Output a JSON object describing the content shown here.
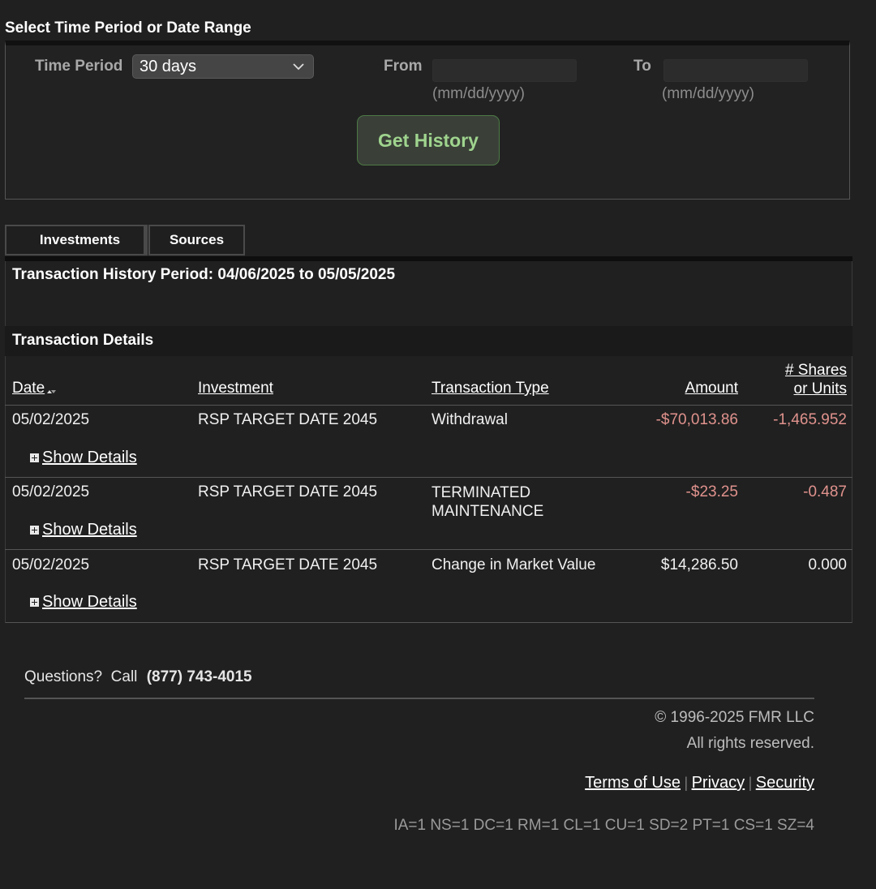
{
  "filter": {
    "section_title": "Select Time Period or Date Range",
    "time_period_label": "Time Period",
    "time_period_value": "30 days",
    "from_label": "From",
    "from_value": "",
    "from_hint": "(mm/dd/yyyy)",
    "to_label": "To",
    "to_value": "",
    "to_hint": "(mm/dd/yyyy)",
    "get_history_label": "Get History"
  },
  "tabs": [
    {
      "label": "Investments"
    },
    {
      "label": "Sources"
    }
  ],
  "period_text": "Transaction History Period: 04/06/2025 to 05/05/2025",
  "details_title": "Transaction Details",
  "table": {
    "columns": {
      "date": "Date",
      "investment": "Investment",
      "type": "Transaction Type",
      "amount": "Amount",
      "shares_line1": "# Shares",
      "shares_line2": "or Units"
    },
    "rows": [
      {
        "date": "05/02/2025",
        "investment": "RSP TARGET DATE 2045",
        "type_line1": "Withdrawal",
        "type_line2": "",
        "amount": "-$70,013.86",
        "shares": "-1,465.952",
        "show_details": "Show Details"
      },
      {
        "date": "05/02/2025",
        "investment": "RSP TARGET DATE 2045",
        "type_line1": "TERMINATED",
        "type_line2": "MAINTENANCE",
        "amount": "-$23.25",
        "shares": "-0.487",
        "show_details": "Show Details"
      },
      {
        "date": "05/02/2025",
        "investment": "RSP TARGET DATE 2045",
        "type_line1": "Change in Market Value",
        "type_line2": "",
        "amount": "$14,286.50",
        "shares": "0.000",
        "show_details": "Show Details"
      }
    ]
  },
  "footer": {
    "questions": "Questions?  Call",
    "phone": "(877) 743-4015",
    "copyright": "© 1996-2025 FMR LLC",
    "rights": "All rights reserved.",
    "links": {
      "terms": "Terms of Use",
      "privacy": "Privacy",
      "security": "Security",
      "separator": "|"
    },
    "debug": "IA=1 NS=1 DC=1 RM=1 CL=1 CU=1 SD=2 PT=1 CS=1 SZ=4"
  },
  "colors": {
    "negative": "#e0928d",
    "button_text": "#9fd48e",
    "background": "#202020"
  }
}
